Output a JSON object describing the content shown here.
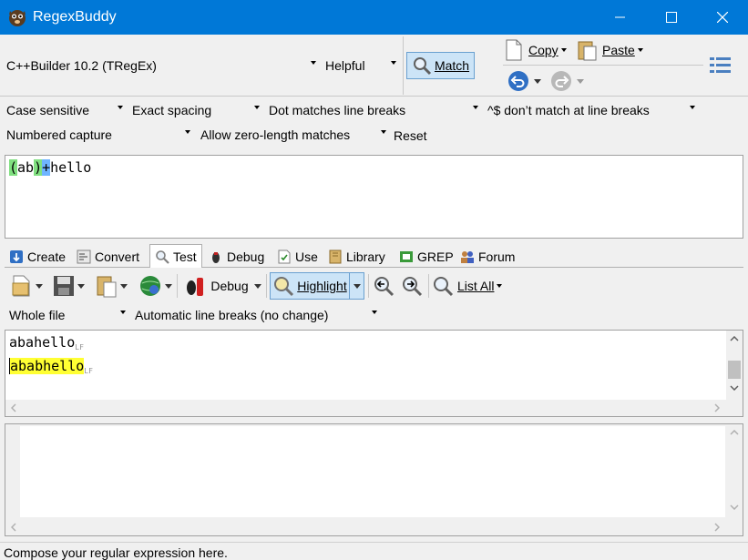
{
  "window": {
    "title": "RegexBuddy"
  },
  "flavor": {
    "engine": "C++Builder 10.2 (TRegEx)",
    "helpful": "Helpful"
  },
  "actions": {
    "match": "Match",
    "copy": "Copy",
    "paste": "Paste"
  },
  "options": {
    "case": "Case sensitive",
    "spacing": "Exact spacing",
    "dot": "Dot matches line breaks",
    "anchors": "^$ don’t match at line breaks",
    "capture": "Numbered capture",
    "zero": "Allow zero-length matches",
    "reset": "Reset"
  },
  "regex": {
    "group_open": "(",
    "group_body": "ab",
    "group_close": ")",
    "quantifier": "+",
    "literal": "hello"
  },
  "tabs": [
    {
      "label": "Create"
    },
    {
      "label": "Convert"
    },
    {
      "label": "Test"
    },
    {
      "label": "Debug"
    },
    {
      "label": "Use"
    },
    {
      "label": "Library"
    },
    {
      "label": "GREP"
    },
    {
      "label": "Forum"
    }
  ],
  "test_toolbar": {
    "debug": "Debug",
    "highlight": "Highlight",
    "list_all": "List All"
  },
  "test_options": {
    "scope": "Whole file",
    "line_breaks": "Automatic line breaks (no change)"
  },
  "subject": {
    "line1": "abahello",
    "line2": "ababhello",
    "line_end_marker": "LF"
  },
  "status": {
    "text": "Compose your regular expression here."
  },
  "colors": {
    "titlebar": "#0078d7",
    "group_green": "#80e080",
    "quant_blue": "#6fb4ff",
    "match_yellow": "#ffff33",
    "highlight_btn": "#cce4f7"
  }
}
